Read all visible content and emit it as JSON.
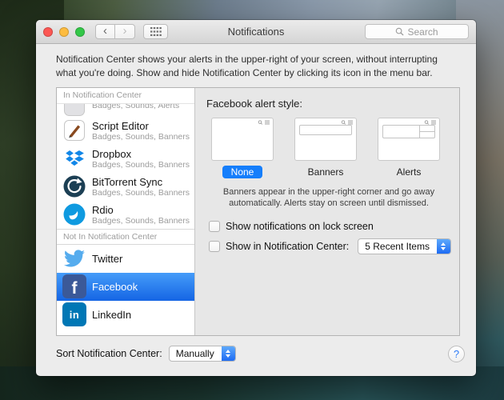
{
  "window": {
    "title": "Notifications",
    "search_placeholder": "Search"
  },
  "intro": {
    "text": "Notification Center shows your alerts in the upper-right of your screen, without interrupting what you're doing. Show and hide Notification Center by clicking its icon in the menu bar."
  },
  "sidebar": {
    "in_header": "In Notification Center",
    "not_in_header": "Not In Notification Center",
    "selected_item": "Facebook",
    "items": [
      {
        "name": "",
        "detail": "Badges, Sounds, Alerts"
      },
      {
        "name": "Script Editor",
        "detail": "Badges, Sounds, Banners"
      },
      {
        "name": "Dropbox",
        "detail": "Badges, Sounds, Banners"
      },
      {
        "name": "BitTorrent Sync",
        "detail": "Badges, Sounds, Banners"
      },
      {
        "name": "Rdio",
        "detail": "Badges, Sounds, Banners"
      },
      {
        "name": "Twitter",
        "detail": ""
      },
      {
        "name": "Facebook",
        "detail": ""
      },
      {
        "name": "LinkedIn",
        "detail": ""
      }
    ]
  },
  "panel": {
    "style_label": "Facebook alert style:",
    "styles": [
      {
        "label": "None",
        "selected": true
      },
      {
        "label": "Banners",
        "selected": false
      },
      {
        "label": "Alerts",
        "selected": false
      }
    ],
    "help_text": "Banners appear in the upper-right corner and go away automatically. Alerts stay on screen until dismissed.",
    "lock_screen_label": "Show notifications on lock screen",
    "lock_screen_checked": false,
    "show_in_center_label": "Show in Notification Center:",
    "show_in_center_checked": false,
    "recent_items_value": "5 Recent Items"
  },
  "footer": {
    "sort_label": "Sort Notification Center:",
    "sort_value": "Manually"
  },
  "icons": {
    "back_glyph": "‹",
    "forward_glyph": "›",
    "help_glyph": "?",
    "facebook_glyph": "f",
    "linkedin_glyph": "in"
  },
  "colors": {
    "selection_blue": "#1f6fe5",
    "accent_blue": "#157efb",
    "facebook_brand": "#3b5998",
    "linkedin_brand": "#0077b5",
    "twitter_brand": "#55acee",
    "dropbox_brand": "#1287e8"
  }
}
